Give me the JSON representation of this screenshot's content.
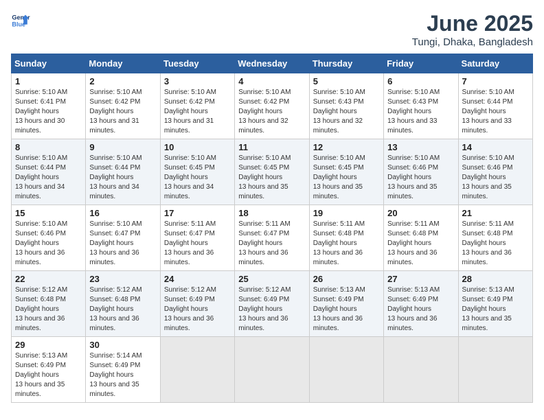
{
  "header": {
    "logo_line1": "General",
    "logo_line2": "Blue",
    "month": "June 2025",
    "location": "Tungi, Dhaka, Bangladesh"
  },
  "weekdays": [
    "Sunday",
    "Monday",
    "Tuesday",
    "Wednesday",
    "Thursday",
    "Friday",
    "Saturday"
  ],
  "weeks": [
    [
      {
        "day": "1",
        "sunrise": "5:10 AM",
        "sunset": "6:41 PM",
        "daylight": "13 hours and 30 minutes."
      },
      {
        "day": "2",
        "sunrise": "5:10 AM",
        "sunset": "6:42 PM",
        "daylight": "13 hours and 31 minutes."
      },
      {
        "day": "3",
        "sunrise": "5:10 AM",
        "sunset": "6:42 PM",
        "daylight": "13 hours and 31 minutes."
      },
      {
        "day": "4",
        "sunrise": "5:10 AM",
        "sunset": "6:42 PM",
        "daylight": "13 hours and 32 minutes."
      },
      {
        "day": "5",
        "sunrise": "5:10 AM",
        "sunset": "6:43 PM",
        "daylight": "13 hours and 32 minutes."
      },
      {
        "day": "6",
        "sunrise": "5:10 AM",
        "sunset": "6:43 PM",
        "daylight": "13 hours and 33 minutes."
      },
      {
        "day": "7",
        "sunrise": "5:10 AM",
        "sunset": "6:44 PM",
        "daylight": "13 hours and 33 minutes."
      }
    ],
    [
      {
        "day": "8",
        "sunrise": "5:10 AM",
        "sunset": "6:44 PM",
        "daylight": "13 hours and 34 minutes."
      },
      {
        "day": "9",
        "sunrise": "5:10 AM",
        "sunset": "6:44 PM",
        "daylight": "13 hours and 34 minutes."
      },
      {
        "day": "10",
        "sunrise": "5:10 AM",
        "sunset": "6:45 PM",
        "daylight": "13 hours and 34 minutes."
      },
      {
        "day": "11",
        "sunrise": "5:10 AM",
        "sunset": "6:45 PM",
        "daylight": "13 hours and 35 minutes."
      },
      {
        "day": "12",
        "sunrise": "5:10 AM",
        "sunset": "6:45 PM",
        "daylight": "13 hours and 35 minutes."
      },
      {
        "day": "13",
        "sunrise": "5:10 AM",
        "sunset": "6:46 PM",
        "daylight": "13 hours and 35 minutes."
      },
      {
        "day": "14",
        "sunrise": "5:10 AM",
        "sunset": "6:46 PM",
        "daylight": "13 hours and 35 minutes."
      }
    ],
    [
      {
        "day": "15",
        "sunrise": "5:10 AM",
        "sunset": "6:46 PM",
        "daylight": "13 hours and 36 minutes."
      },
      {
        "day": "16",
        "sunrise": "5:10 AM",
        "sunset": "6:47 PM",
        "daylight": "13 hours and 36 minutes."
      },
      {
        "day": "17",
        "sunrise": "5:11 AM",
        "sunset": "6:47 PM",
        "daylight": "13 hours and 36 minutes."
      },
      {
        "day": "18",
        "sunrise": "5:11 AM",
        "sunset": "6:47 PM",
        "daylight": "13 hours and 36 minutes."
      },
      {
        "day": "19",
        "sunrise": "5:11 AM",
        "sunset": "6:48 PM",
        "daylight": "13 hours and 36 minutes."
      },
      {
        "day": "20",
        "sunrise": "5:11 AM",
        "sunset": "6:48 PM",
        "daylight": "13 hours and 36 minutes."
      },
      {
        "day": "21",
        "sunrise": "5:11 AM",
        "sunset": "6:48 PM",
        "daylight": "13 hours and 36 minutes."
      }
    ],
    [
      {
        "day": "22",
        "sunrise": "5:12 AM",
        "sunset": "6:48 PM",
        "daylight": "13 hours and 36 minutes."
      },
      {
        "day": "23",
        "sunrise": "5:12 AM",
        "sunset": "6:48 PM",
        "daylight": "13 hours and 36 minutes."
      },
      {
        "day": "24",
        "sunrise": "5:12 AM",
        "sunset": "6:49 PM",
        "daylight": "13 hours and 36 minutes."
      },
      {
        "day": "25",
        "sunrise": "5:12 AM",
        "sunset": "6:49 PM",
        "daylight": "13 hours and 36 minutes."
      },
      {
        "day": "26",
        "sunrise": "5:13 AM",
        "sunset": "6:49 PM",
        "daylight": "13 hours and 36 minutes."
      },
      {
        "day": "27",
        "sunrise": "5:13 AM",
        "sunset": "6:49 PM",
        "daylight": "13 hours and 36 minutes."
      },
      {
        "day": "28",
        "sunrise": "5:13 AM",
        "sunset": "6:49 PM",
        "daylight": "13 hours and 35 minutes."
      }
    ],
    [
      {
        "day": "29",
        "sunrise": "5:13 AM",
        "sunset": "6:49 PM",
        "daylight": "13 hours and 35 minutes."
      },
      {
        "day": "30",
        "sunrise": "5:14 AM",
        "sunset": "6:49 PM",
        "daylight": "13 hours and 35 minutes."
      },
      null,
      null,
      null,
      null,
      null
    ]
  ],
  "labels": {
    "sunrise": "Sunrise:",
    "sunset": "Sunset:",
    "daylight": "Daylight hours"
  }
}
